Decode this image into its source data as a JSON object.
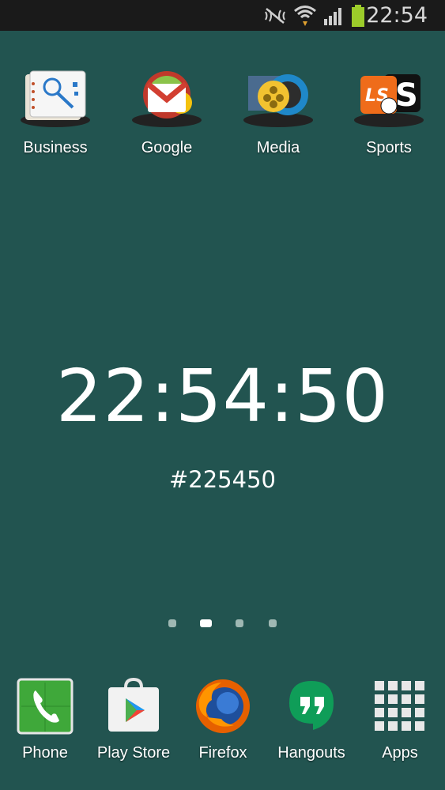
{
  "status_bar": {
    "time": "22:54",
    "icons": [
      "silent-mode-icon",
      "wifi-icon",
      "signal-icon",
      "battery-icon"
    ],
    "battery_color": "#9ccc2a"
  },
  "home": {
    "background_color": "#225450",
    "folders": [
      {
        "label": "Business",
        "icon": "business-folder-icon"
      },
      {
        "label": "Google",
        "icon": "google-folder-icon"
      },
      {
        "label": "Media",
        "icon": "media-folder-icon"
      },
      {
        "label": "Sports",
        "icon": "sports-folder-icon"
      }
    ],
    "clock_widget": {
      "time": "22:54:50",
      "hex": "#225450"
    },
    "page_indicator": {
      "pages": 4,
      "current": 2
    }
  },
  "dock": [
    {
      "label": "Phone",
      "icon": "phone-icon"
    },
    {
      "label": "Play Store",
      "icon": "play-store-icon"
    },
    {
      "label": "Firefox",
      "icon": "firefox-icon"
    },
    {
      "label": "Hangouts",
      "icon": "hangouts-icon"
    },
    {
      "label": "Apps",
      "icon": "apps-grid-icon"
    }
  ]
}
